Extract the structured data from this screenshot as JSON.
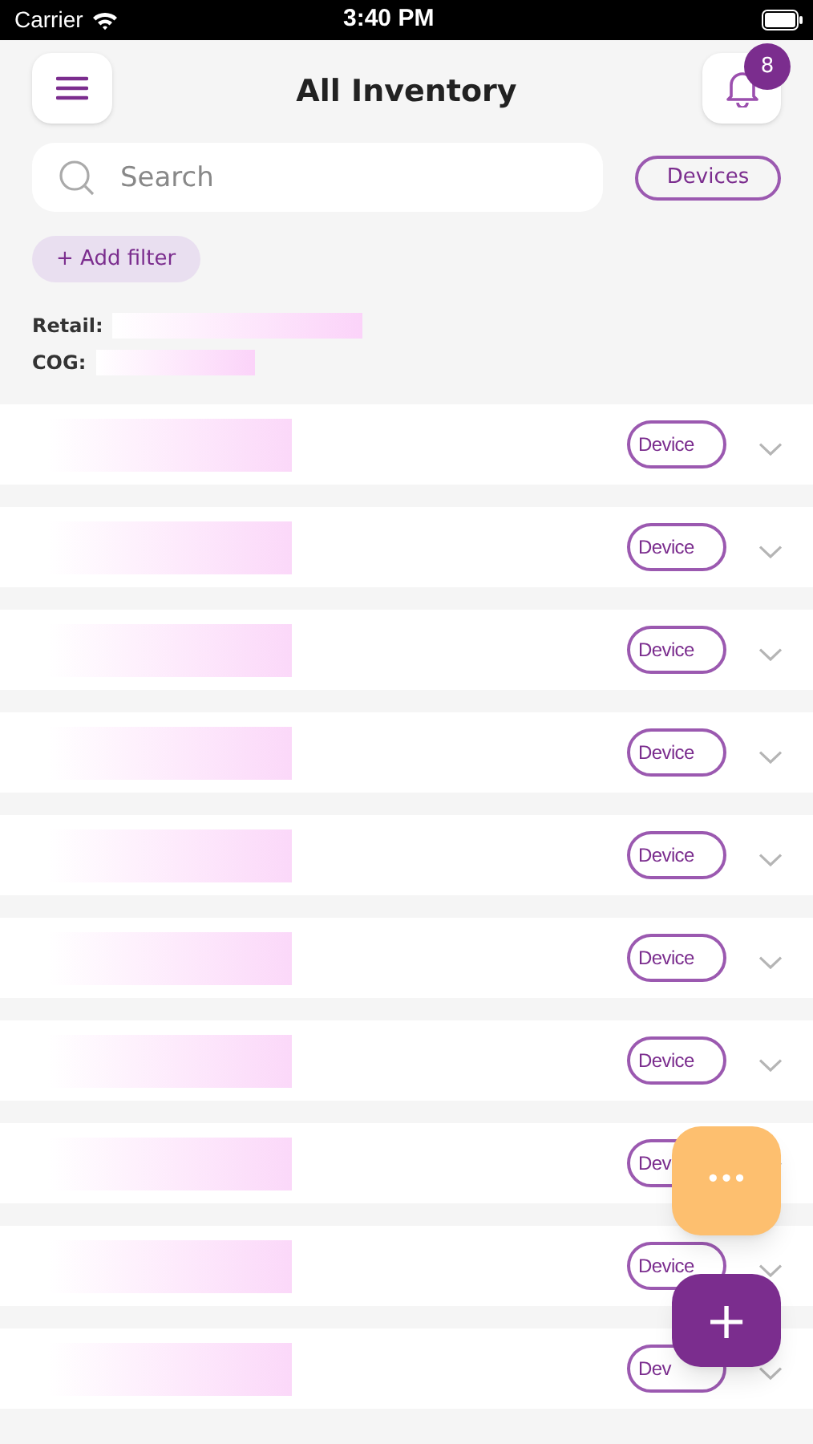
{
  "status_bar": {
    "carrier": "Carrier",
    "time": "3:40 PM"
  },
  "header": {
    "title": "All Inventory",
    "notification_count": "8"
  },
  "search": {
    "placeholder": "Search"
  },
  "type_filter": "Devices",
  "add_filter": "+ Add filter",
  "totals": [
    {
      "label": "Retail:"
    },
    {
      "label": "COG:"
    }
  ],
  "items": [
    {
      "tag": "Device"
    },
    {
      "tag": "Device"
    },
    {
      "tag": "Device"
    },
    {
      "tag": "Device"
    },
    {
      "tag": "Device"
    },
    {
      "tag": "Device"
    },
    {
      "tag": "Device"
    },
    {
      "tag": "Dev"
    },
    {
      "tag": "Device"
    },
    {
      "tag": "Dev"
    }
  ],
  "fabs": [
    {
      "kind": "more",
      "label": "•••"
    },
    {
      "kind": "add",
      "label": "+"
    }
  ]
}
